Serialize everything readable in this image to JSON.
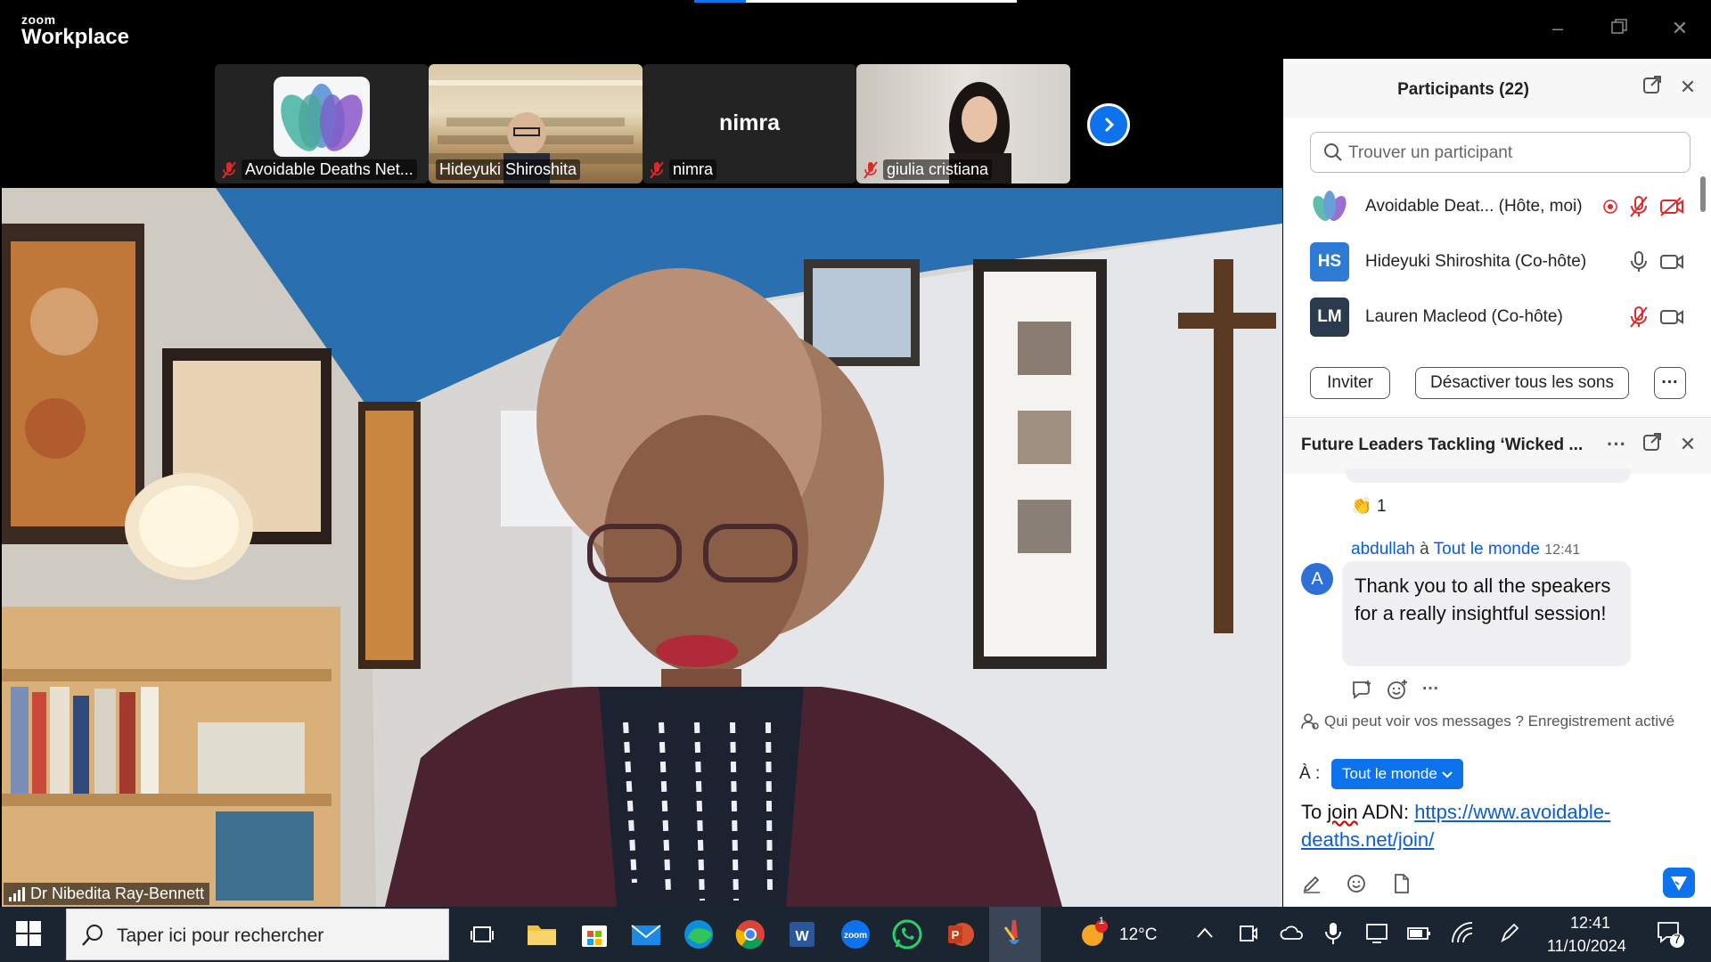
{
  "app": {
    "brand_top": "zoom",
    "brand_bottom": "Workplace",
    "accent": "#0e72ed",
    "progress": 0.16
  },
  "thumbnails": [
    {
      "name": "Avoidable Deaths Net...",
      "muted": true,
      "type": "logo"
    },
    {
      "name": "Hideyuki Shiroshita",
      "muted": false,
      "type": "video"
    },
    {
      "name": "nimra",
      "muted": true,
      "type": "name-only",
      "display": "nimra"
    },
    {
      "name": "giulia cristiana",
      "muted": true,
      "type": "video"
    }
  ],
  "main_video": {
    "speaker": "Dr Nibedita Ray-Bennett"
  },
  "participants": {
    "title": "Participants (22)",
    "search_placeholder": "Trouver un participant",
    "list": [
      {
        "initials": "",
        "name": "Avoidable Deat... (Hôte, moi)",
        "color": "#ffffff",
        "recording": true,
        "mic": "muted",
        "cam": "off"
      },
      {
        "initials": "HS",
        "name": "Hideyuki Shiroshita (Co-hôte)",
        "color": "#2e7bd6",
        "recording": false,
        "mic": "on",
        "cam": "on"
      },
      {
        "initials": "LM",
        "name": "Lauren Macleod (Co-hôte)",
        "color": "#2b3a4e",
        "recording": false,
        "mic": "muted",
        "cam": "on"
      }
    ],
    "invite_label": "Inviter",
    "mute_all_label": "Désactiver tous les sons",
    "more_label": "···"
  },
  "chat": {
    "title": "Future Leaders Tackling ‘Wicked ...",
    "more_label": "···",
    "reaction_emoji": "👏",
    "reaction_count": "1",
    "message": {
      "sender": "abdullah",
      "to_word": "à",
      "recipient": "Tout le monde",
      "time": "12:41",
      "avatar": "A",
      "text": "Thank you to all the speakers for a really insightful session!"
    },
    "more_actions": "···",
    "privacy_text": "Qui peut voir vos messages ? Enregistrement activé",
    "to_label": "À :",
    "to_value": "Tout le monde",
    "compose_prefix": "To ",
    "compose_word": "join",
    "compose_mid": " ADN: ",
    "compose_link": "https://www.avoidable-deaths.net/join/"
  },
  "taskbar": {
    "search_placeholder": "Taper ici pour rechercher",
    "apps": [
      "task-view",
      "file-explorer",
      "microsoft-store",
      "mail",
      "edge",
      "chrome",
      "word",
      "zoom",
      "whatsapp",
      "powerpoint",
      "paint"
    ],
    "weather_badge": "1",
    "weather": "12°C",
    "time": "12:41",
    "date": "11/10/2024",
    "notifications": "7"
  }
}
